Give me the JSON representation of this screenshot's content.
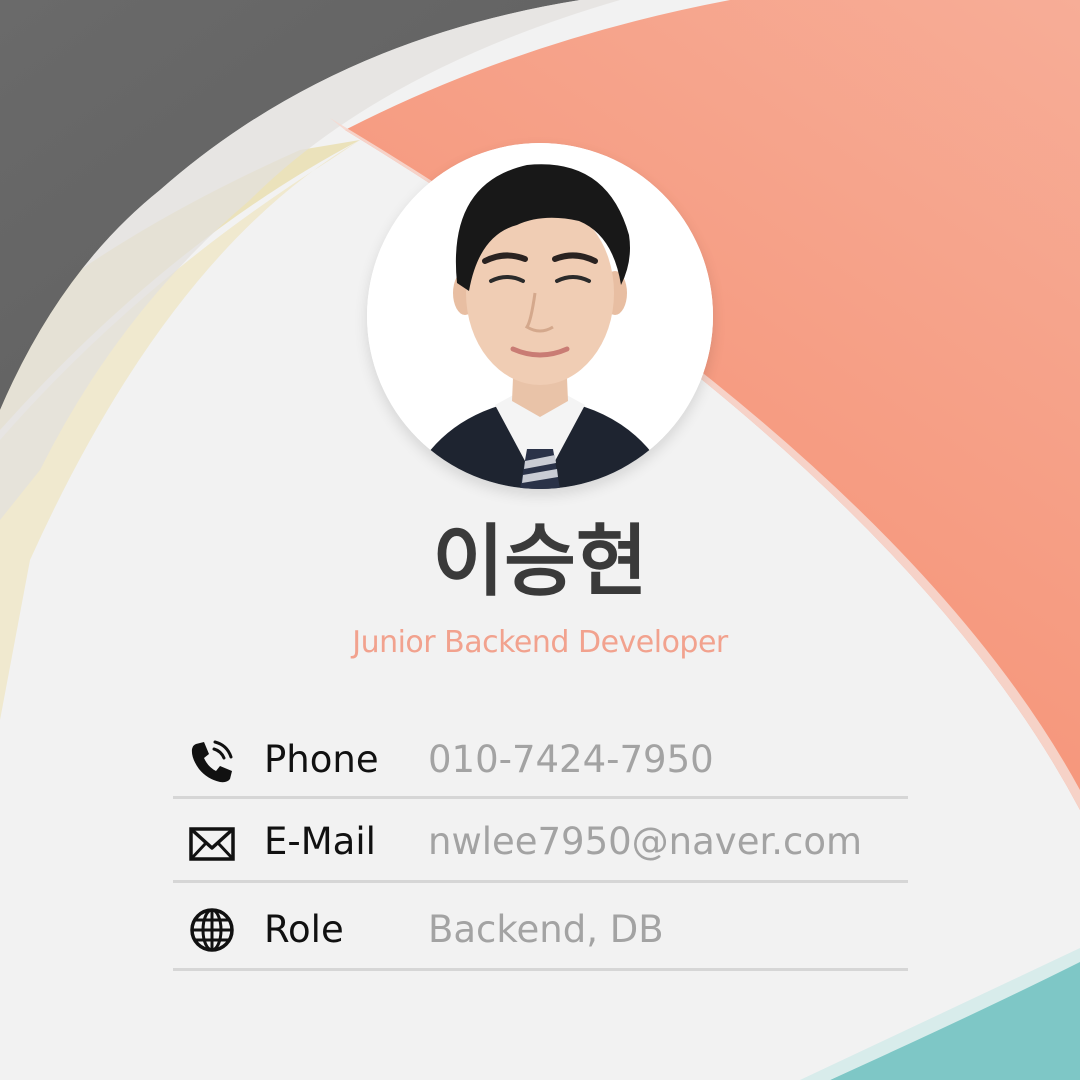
{
  "profile": {
    "name": "이승현",
    "title": "Junior Backend Developer",
    "photo": "profile-photo"
  },
  "contacts": [
    {
      "icon": "phone-icon",
      "label": "Phone",
      "value": "010-7424-7950"
    },
    {
      "icon": "mail-icon",
      "label": "E-Mail",
      "value": "nwlee7950@naver.com"
    },
    {
      "icon": "globe-icon",
      "label": "Role",
      "value": "Backend, DB"
    }
  ],
  "colors": {
    "background": "#f2f2f2",
    "coral": "#f7967a",
    "dark_gray": "#6b6b6b",
    "cream": "#eadfb2",
    "teal": "#7ec7c6",
    "name_text": "#3a3a3a",
    "title_text": "#f2a28e",
    "value_text": "#a3a3a3",
    "divider": "#d6d6d6"
  }
}
